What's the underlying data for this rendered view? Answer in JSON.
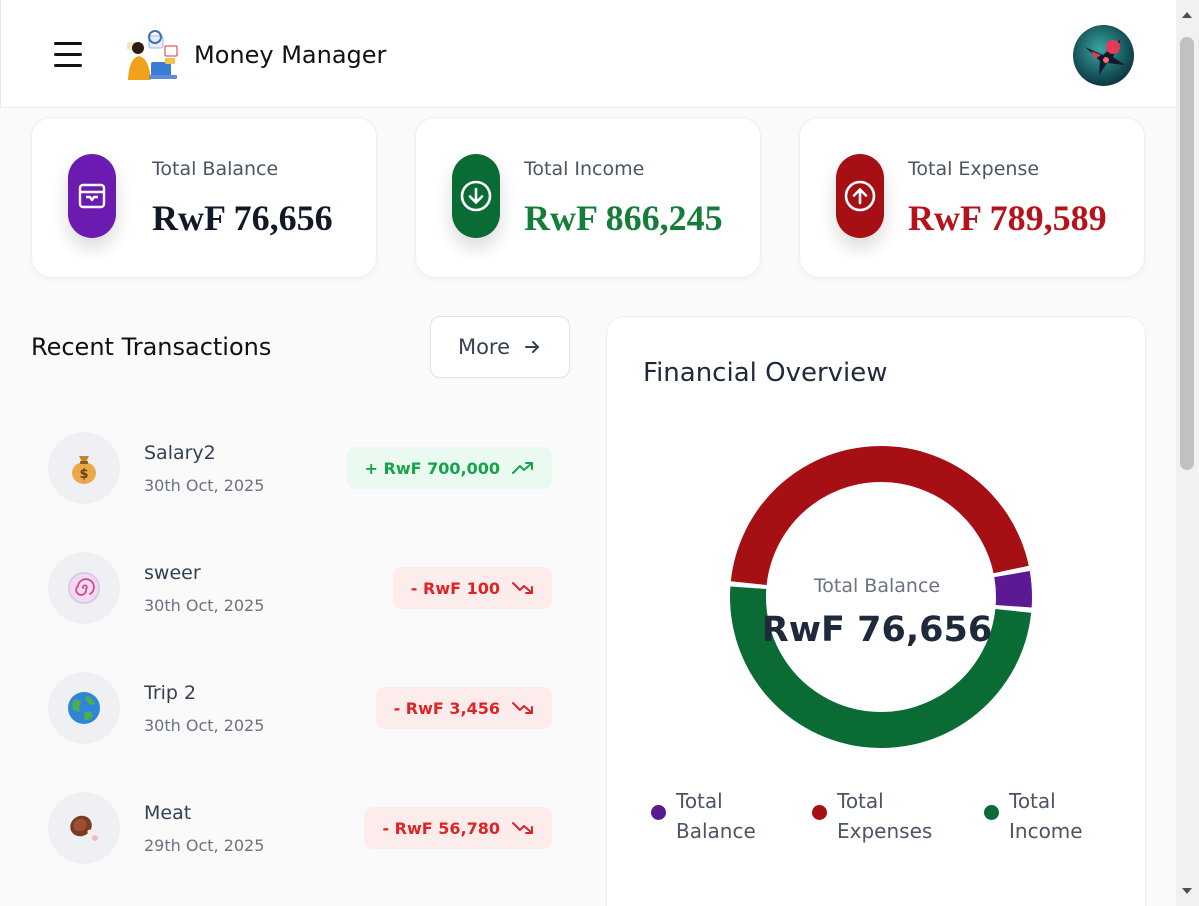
{
  "header": {
    "app_title": "Money Manager",
    "menu_icon": "hamburger-menu-icon",
    "logo_icon": "person-laptop-illustration",
    "avatar_icon": "user-avatar"
  },
  "stats": [
    {
      "label": "Total Balance",
      "value": "RwF 76,656",
      "icon": "wallet-icon",
      "color": "#6b1bb0"
    },
    {
      "label": "Total Income",
      "value": "RwF 866,245",
      "icon": "arrow-down-circle-icon",
      "color": "#0a6b35"
    },
    {
      "label": "Total Expense",
      "value": "RwF 789,589",
      "icon": "arrow-up-circle-icon",
      "color": "#a60f14"
    }
  ],
  "recent": {
    "title": "Recent Transactions",
    "more_label": "More",
    "items": [
      {
        "name": "Salary2",
        "date": "30th Oct, 2025",
        "amount": "+ RwF 700,000",
        "type": "income",
        "emoji": "💰",
        "icon": "money-bag-icon"
      },
      {
        "name": "sweer",
        "date": "30th Oct, 2025",
        "amount": "- RwF 100",
        "type": "expense",
        "emoji": "🍥",
        "icon": "swirl-candy-icon"
      },
      {
        "name": "Trip 2",
        "date": "30th Oct, 2025",
        "amount": "- RwF 3,456",
        "type": "expense",
        "emoji": "🌍",
        "icon": "globe-icon"
      },
      {
        "name": "Meat",
        "date": "29th Oct, 2025",
        "amount": "- RwF 56,780",
        "type": "expense",
        "emoji": "🍖",
        "icon": "meat-icon"
      }
    ]
  },
  "overview": {
    "title": "Financial Overview",
    "center_label": "Total Balance",
    "center_value": "RwF 76,656"
  },
  "chart_data": {
    "type": "pie",
    "variant": "donut",
    "title": "Financial Overview",
    "categories": [
      "Total Balance",
      "Total Expenses",
      "Total Income"
    ],
    "values": [
      76656,
      789589,
      866245
    ],
    "colors": [
      "#5b1a93",
      "#a60f14",
      "#0a6b35"
    ],
    "legend": "bottom"
  }
}
